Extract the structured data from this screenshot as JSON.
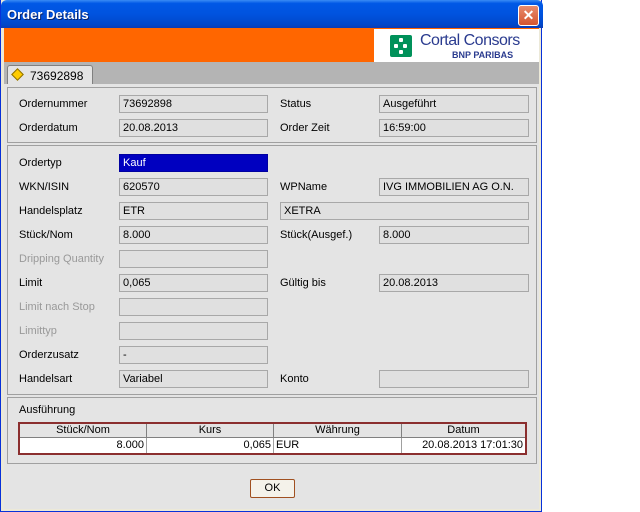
{
  "window": {
    "title": "Order Details",
    "close_glyph": "✕"
  },
  "banner": {
    "brand_name": "Cortal Consors",
    "brand_sub": "BNP PARIBAS",
    "brand_color": "#ff6600"
  },
  "tab": {
    "label": "73692898",
    "icon": "diamond-icon"
  },
  "section1": {
    "ordernummer_label": "Ordernummer",
    "ordernummer": "73692898",
    "status_label": "Status",
    "status": "Ausgeführt",
    "orderdatum_label": "Orderdatum",
    "orderdatum": "20.08.2013",
    "orderzeit_label": "Order Zeit",
    "orderzeit": "16:59:00"
  },
  "section2": {
    "ordertyp_label": "Ordertyp",
    "ordertyp": "Kauf",
    "wkn_label": "WKN/ISIN",
    "wkn": "620570",
    "wpname_label": "WPName",
    "wpname": "IVG IMMOBILIEN AG O.N.",
    "handelsplatz_label": "Handelsplatz",
    "handelsplatz": "ETR",
    "handelsplatz_name": "XETRA",
    "stueck_label": "Stück/Nom",
    "stueck": "8.000",
    "stueck_ausgef_label": "Stück(Ausgef.)",
    "stueck_ausgef": "8.000",
    "dripping_label": "Dripping Quantity",
    "dripping": "",
    "limit_label": "Limit",
    "limit": "0,065",
    "gueltig_label": "Gültig bis",
    "gueltig": "20.08.2013",
    "limit_stop_label": "Limit nach Stop",
    "limit_stop": "",
    "limittyp_label": "Limittyp",
    "limittyp": "",
    "orderzusatz_label": "Orderzusatz",
    "orderzusatz": "-",
    "handelsart_label": "Handelsart",
    "handelsart": "Variabel",
    "konto_label": "Konto",
    "konto": ""
  },
  "execution": {
    "title": "Ausführung",
    "headers": [
      "Stück/Nom",
      "Kurs",
      "Währung",
      "Datum"
    ],
    "rows": [
      [
        "8.000",
        "0,065",
        "EUR",
        "20.08.2013 17:01:30"
      ]
    ]
  },
  "ok_label": "OK"
}
